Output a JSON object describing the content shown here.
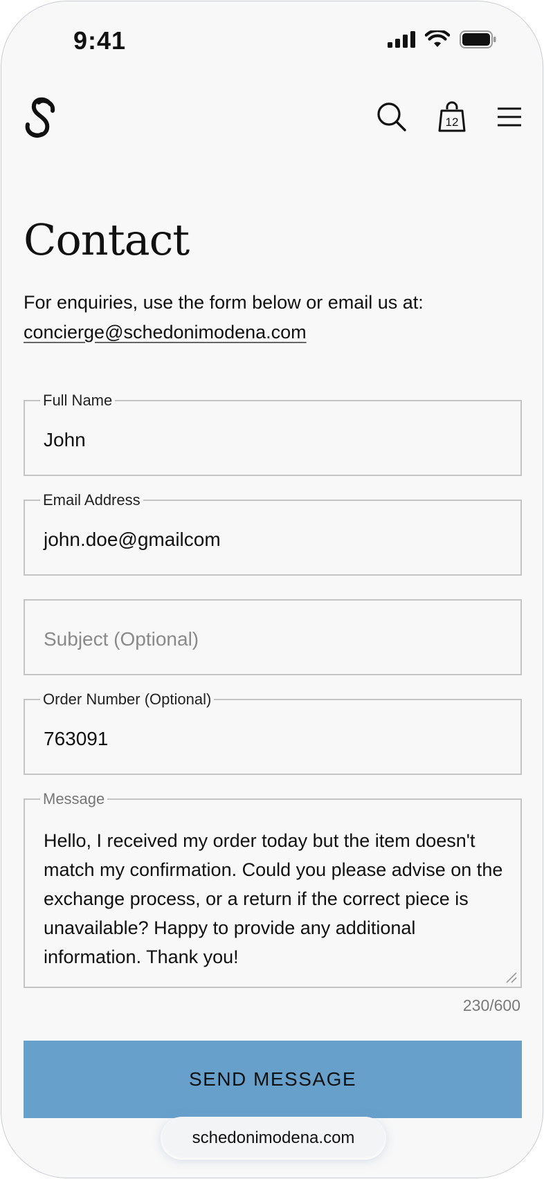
{
  "status_bar": {
    "time": "9:41"
  },
  "header": {
    "logo_icon": "brand-s-logo-icon",
    "cart_count": "12",
    "icons": [
      "search-icon",
      "shopping-bag-icon",
      "menu-icon"
    ]
  },
  "page": {
    "title": "Contact",
    "intro_text": "For enquiries, use the form below or email us at:",
    "email_link": "concierge@schedonimodena.com"
  },
  "form": {
    "full_name": {
      "label": "Full Name",
      "value": "John"
    },
    "email": {
      "label": "Email Address",
      "value": "john.doe@gmailcom"
    },
    "subject": {
      "placeholder": "Subject (Optional)"
    },
    "order_number": {
      "label": "Order Number (Optional)",
      "value": "763091"
    },
    "message": {
      "label": "Message",
      "value": "Hello, I received my order today but the item doesn't match my confirmation. Could you please advise on the exchange process, or a return if the correct piece is unavailable? Happy to provide any additional information. Thank you!",
      "counter": "230/600"
    },
    "submit_label": "SEND MESSAGE"
  },
  "browser": {
    "url": "schedonimodena.com"
  },
  "colors": {
    "accent": "#66a0cb",
    "background": "#f8f8f8",
    "border": "#c4c4c4"
  }
}
